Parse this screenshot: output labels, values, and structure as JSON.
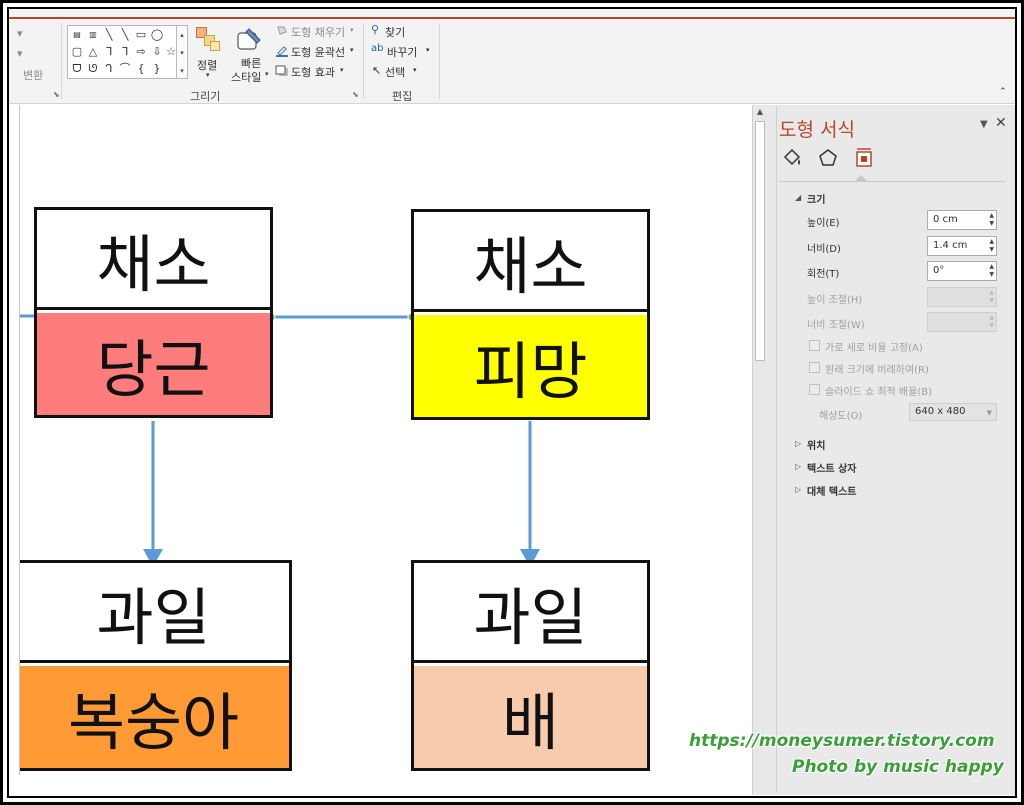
{
  "ribbon": {
    "left_labels": [
      "변환"
    ],
    "drawing": {
      "group_label": "그리기",
      "arrange_label": "정렬",
      "quick_styles_label_1": "빠른",
      "quick_styles_label_2": "스타일",
      "shape_fill": "도형 채우기",
      "shape_outline": "도형 윤곽선",
      "shape_effects": "도형 효과"
    },
    "editing": {
      "group_label": "편집",
      "find": "찾기",
      "replace": "바꾸기",
      "select": "선택"
    }
  },
  "diagram": {
    "nodes": [
      {
        "top": "채소",
        "bottom": "당근",
        "color": "#ff7c7c"
      },
      {
        "top": "채소",
        "bottom": "피망",
        "color": "#ffff00"
      },
      {
        "top": "과일",
        "bottom": "복숭아",
        "color": "#ff9a34"
      },
      {
        "top": "과일",
        "bottom": "배",
        "color": "#f8cbad"
      }
    ],
    "connector_color": "#5b9bd5"
  },
  "pane": {
    "title": "도형 서식",
    "size_section": "크기",
    "height_label": "높이(E)",
    "height_value": "0 cm",
    "width_label": "너비(D)",
    "width_value": "1.4 cm",
    "rotation_label": "회전(T)",
    "rotation_value": "0°",
    "scale_height_label": "높이 조절(H)",
    "scale_width_label": "너비 조절(W)",
    "lock_aspect_label": "가로 세로 비율 고정(A)",
    "relative_original_label": "원래 크기에 비례하여(R)",
    "best_scale_label": "슬라이드 쇼 최적 배율(B)",
    "resolution_label": "해상도(O)",
    "resolution_value": "640 x 480",
    "position_section": "위치",
    "textbox_section": "텍스트 상자",
    "alt_text_section": "대체 텍스트"
  },
  "credits": {
    "url": "https://moneysumer.tistory.com",
    "by": "Photo by music happy"
  }
}
